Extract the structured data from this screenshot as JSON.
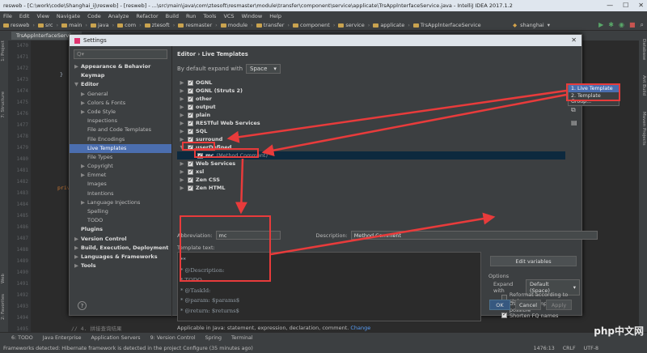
{
  "window": {
    "title": "resweb - [C:\\work\\code\\Shanghai_ij\\resweb] - [resweb] - ...\\src\\main\\java\\com\\ztesoft\\resmaster\\module\\transfer\\component\\service\\applicate\\TrsApplnterfaceService.java - IntelliJ IDEA 2017.1.2"
  },
  "menu": [
    "File",
    "Edit",
    "View",
    "Navigate",
    "Code",
    "Analyze",
    "Refactor",
    "Build",
    "Run",
    "Tools",
    "VCS",
    "Window",
    "Help"
  ],
  "breadcrumbs": [
    "resweb",
    "src",
    "main",
    "java",
    "com",
    "ztesoft",
    "resmaster",
    "module",
    "transfer",
    "component",
    "service",
    "applicate",
    "TrsApplnterfaceService"
  ],
  "run_config": "shanghai",
  "editor_tab": "TrsApplnterfaceService",
  "left_tools": [
    "1: Project",
    "7: Structure",
    "2: Favorites",
    "Web"
  ],
  "right_tools": [
    "Database",
    "Ant Build",
    "Maven Projects"
  ],
  "gutter_lines": [
    "1470",
    "1471",
    "1472",
    "1473",
    "1474",
    "1475",
    "1476",
    "1477",
    "1478",
    "1479",
    "1480",
    "1481",
    "1482",
    "1483",
    "1484",
    "1485",
    "1486",
    "1487",
    "1488",
    "1489",
    "1490",
    "1491",
    "1492",
    "1493",
    "1494",
    "1495"
  ],
  "code_fragments": {
    "brace": "}",
    "private": "priv",
    "comment": "// 4. 拼接查询结果"
  },
  "settings": {
    "title": "Settings",
    "search_placeholder": "Q▾",
    "tree": [
      {
        "label": "Appearance & Behavior",
        "level": 0,
        "arrow": "▶",
        "bold": true
      },
      {
        "label": "Keymap",
        "level": 0,
        "arrow": "",
        "bold": true
      },
      {
        "label": "Editor",
        "level": 0,
        "arrow": "▼",
        "bold": true
      },
      {
        "label": "General",
        "level": 1,
        "arrow": "▶"
      },
      {
        "label": "Colors & Fonts",
        "level": 1,
        "arrow": "▶"
      },
      {
        "label": "Code Style",
        "level": 1,
        "arrow": "▶"
      },
      {
        "label": "Inspections",
        "level": 1,
        "arrow": ""
      },
      {
        "label": "File and Code Templates",
        "level": 1,
        "arrow": ""
      },
      {
        "label": "File Encodings",
        "level": 1,
        "arrow": ""
      },
      {
        "label": "Live Templates",
        "level": 1,
        "arrow": "",
        "selected": true
      },
      {
        "label": "File Types",
        "level": 1,
        "arrow": ""
      },
      {
        "label": "Copyright",
        "level": 1,
        "arrow": "▶"
      },
      {
        "label": "Emmet",
        "level": 1,
        "arrow": "▶"
      },
      {
        "label": "Images",
        "level": 1,
        "arrow": ""
      },
      {
        "label": "Intentions",
        "level": 1,
        "arrow": ""
      },
      {
        "label": "Language Injections",
        "level": 1,
        "arrow": "▶"
      },
      {
        "label": "Spelling",
        "level": 1,
        "arrow": ""
      },
      {
        "label": "TODO",
        "level": 1,
        "arrow": ""
      },
      {
        "label": "Plugins",
        "level": 0,
        "arrow": "",
        "bold": true
      },
      {
        "label": "Version Control",
        "level": 0,
        "arrow": "▶",
        "bold": true
      },
      {
        "label": "Build, Execution, Deployment",
        "level": 0,
        "arrow": "▶",
        "bold": true
      },
      {
        "label": "Languages & Frameworks",
        "level": 0,
        "arrow": "▶",
        "bold": true
      },
      {
        "label": "Tools",
        "level": 0,
        "arrow": "▶",
        "bold": true
      }
    ],
    "header": "Editor › Live Templates",
    "expand_label": "By default expand with",
    "expand_value": "Space",
    "templates": [
      {
        "label": "OGNL",
        "arrow": "▶"
      },
      {
        "label": "OGNL (Struts 2)",
        "arrow": "▶"
      },
      {
        "label": "other",
        "arrow": "▶"
      },
      {
        "label": "output",
        "arrow": "▶"
      },
      {
        "label": "plain",
        "arrow": "▶"
      },
      {
        "label": "RESTful Web Services",
        "arrow": "▶"
      },
      {
        "label": "SQL",
        "arrow": "▶"
      },
      {
        "label": "surround",
        "arrow": "▶"
      },
      {
        "label": "userDefined",
        "arrow": "▼"
      },
      {
        "label": "mc",
        "desc": "(Method Comment)",
        "arrow": "",
        "child": true,
        "selected": true
      },
      {
        "label": "Web Services",
        "arrow": "▶"
      },
      {
        "label": "xsl",
        "arrow": "▶"
      },
      {
        "label": "Zen CSS",
        "arrow": "▶"
      },
      {
        "label": "Zen HTML",
        "arrow": "▶"
      }
    ],
    "side_buttons": [
      "+",
      "−",
      "⧉",
      "▤"
    ],
    "popup": [
      "1. Live Template",
      "2. Template Group..."
    ],
    "abbreviation_label": "Abbreviation:",
    "abbreviation_value": "mc",
    "description_label": "Description:",
    "description_value": "Method Comment",
    "template_text_label": "Template text:",
    "template_lines": [
      "**",
      " * @Description:",
      " * TODO",
      " * @TaskId:",
      " * @param: $params$",
      " * @return: $returns$"
    ],
    "edit_variables": "Edit variables",
    "options_label": "Options",
    "expand_with_label": "Expand with",
    "expand_with_value": "Default (Space)",
    "opt_reformat": "Reformat according to style",
    "opt_static_import": "Use static import if possible",
    "opt_shorten": "Shorten FQ names",
    "applicable_text": "Applicable in Java: statement, expression, declaration, comment.",
    "applicable_link": "Change",
    "ok": "OK",
    "cancel": "Cancel",
    "apply": "Apply",
    "help": "?"
  },
  "bottom_tools": [
    "6: TODO",
    "Java Enterprise",
    "Application Servers",
    "9: Version Control",
    "Spring",
    "Terminal"
  ],
  "status": {
    "message": "Frameworks detected: Hibernate framework is detected in the project Configure (35 minutes ago)",
    "position": "1476:13",
    "line_sep": "CRLF",
    "encoding": "UTF-8"
  },
  "watermark": "php中文网",
  "colors": {
    "accent": "#4b6eaf",
    "annotation_red": "#e83b3b",
    "dark_bg": "#2b2b2b",
    "panel": "#3c3f41"
  }
}
